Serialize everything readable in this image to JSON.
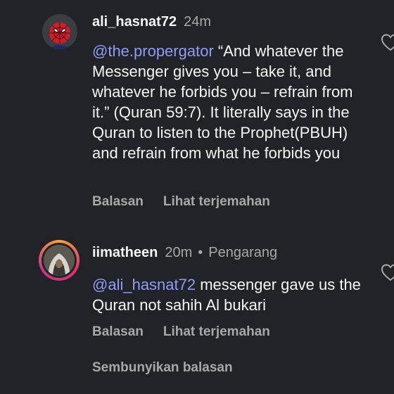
{
  "comments": [
    {
      "username": "ali_hasnat72",
      "time": "24m",
      "author_tag": "",
      "mention": "@the.propergator",
      "text": " “And whatever the Messenger gives you – take it, and whatever he forbids you – refrain from it.” (Quran 59:7). It literally says in the Quran to listen to the Prophet(PBUH) and refrain from what he forbids you",
      "reply_label": "Balasan",
      "translate_label": "Lihat terjemahan",
      "avatar_icon": "spiderman-avatar-icon"
    },
    {
      "username": "iimatheen",
      "time": "20m",
      "author_tag": "Pengarang",
      "mention": "@ali_hasnat72",
      "text": " messenger gave us the Quran not sahih Al bukari",
      "reply_label": "Balasan",
      "translate_label": "Lihat terjemahan",
      "avatar_icon": "hooded-figure-avatar-icon"
    }
  ],
  "hide_replies_label": "Sembunyikan balasan",
  "colors": {
    "background": "#212328",
    "mention": "#8f9cf6",
    "secondary_text": "#a8a8a8"
  }
}
